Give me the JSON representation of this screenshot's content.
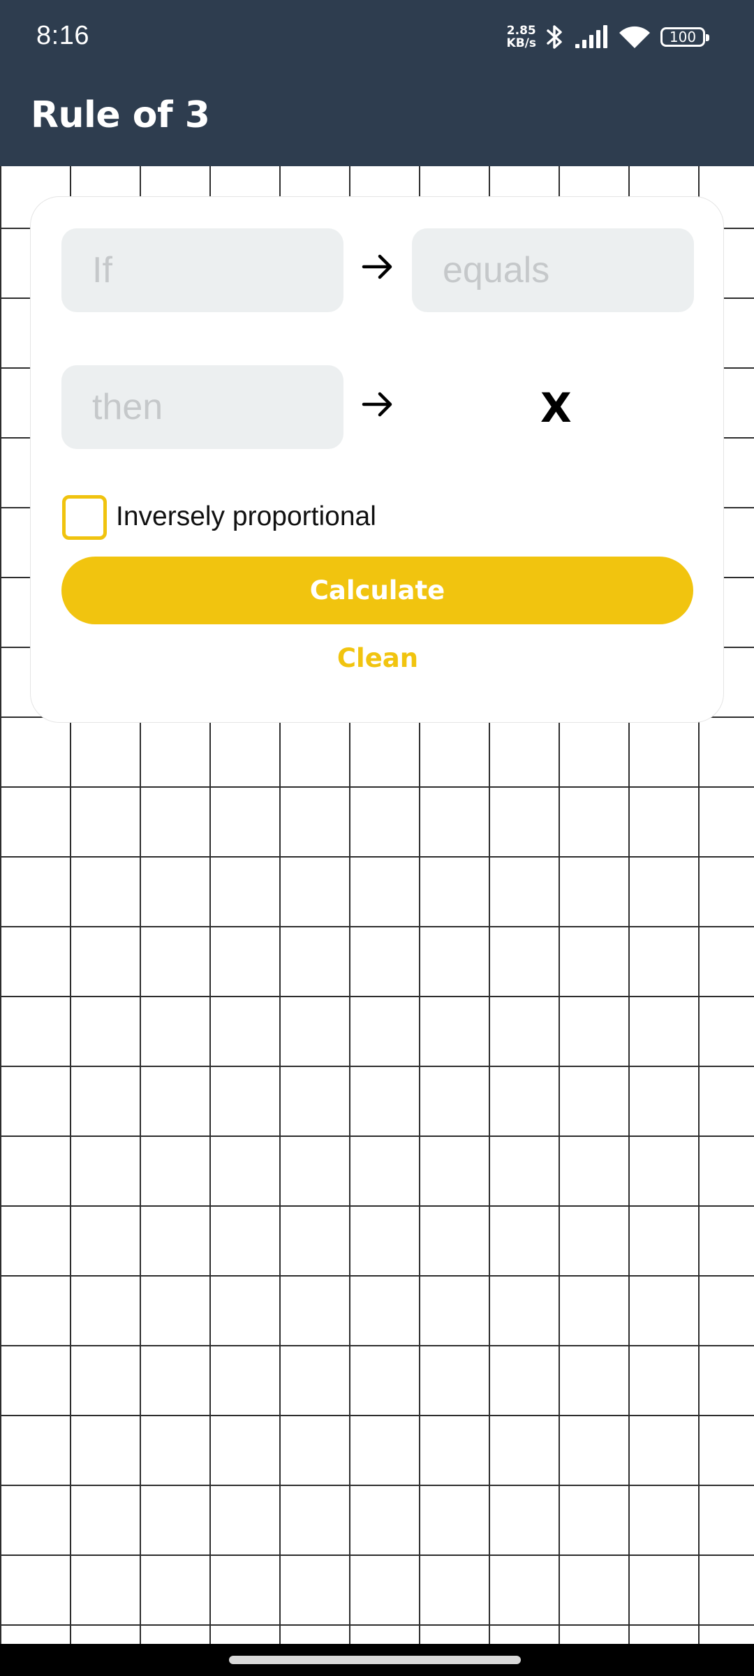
{
  "status_bar": {
    "time": "8:16",
    "net_speed_value": "2.85",
    "net_speed_unit": "KB/s",
    "battery": "100"
  },
  "app_bar": {
    "title": "Rule of 3"
  },
  "form": {
    "if_placeholder": "If",
    "equals_placeholder": "equals",
    "then_placeholder": "then",
    "unknown_symbol": "X",
    "inverse_label": "Inversely proportional",
    "inverse_checked": false,
    "calculate_label": "Calculate",
    "clean_label": "Clean"
  },
  "colors": {
    "app_bar": "#2e3d4f",
    "accent": "#f1c40f",
    "field_background": "#eceff0",
    "grid_line": "#2d2d2d"
  },
  "icons": {
    "arrow": "arrow-right-icon",
    "bluetooth": "bluetooth-icon",
    "signal": "signal-icon",
    "wifi": "wifi-icon",
    "battery": "battery-icon"
  }
}
